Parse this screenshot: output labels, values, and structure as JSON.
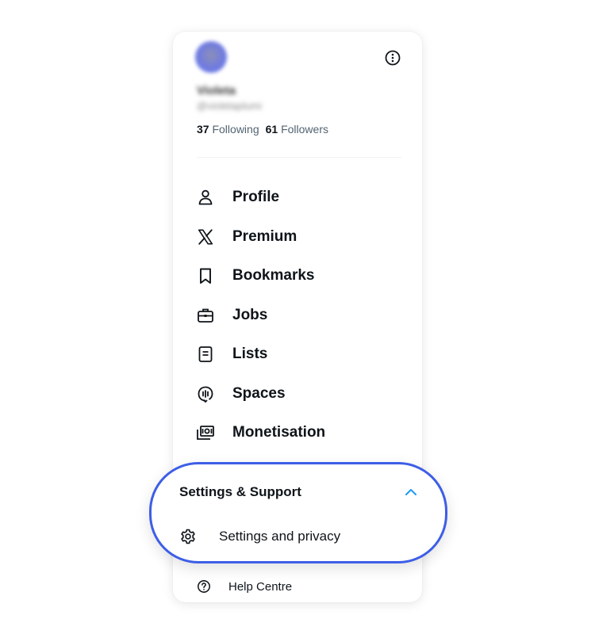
{
  "profile": {
    "name_blurred": "Violeta",
    "handle_blurred": "@violetaplumi",
    "following_count": "37",
    "following_label": "Following",
    "followers_count": "61",
    "followers_label": "Followers"
  },
  "nav": {
    "profile": "Profile",
    "premium": "Premium",
    "bookmarks": "Bookmarks",
    "jobs": "Jobs",
    "lists": "Lists",
    "spaces": "Spaces",
    "monetisation": "Monetisation"
  },
  "settings_support": {
    "title": "Settings & Support",
    "settings_and_privacy": "Settings and privacy",
    "help_centre": "Help Centre"
  },
  "colors": {
    "highlight_border": "#3d5ee6",
    "chevron": "#1d9bf0",
    "text_primary": "#0f1419",
    "text_secondary": "#536471"
  },
  "icons": [
    "more-icon",
    "person-icon",
    "x-logo-icon",
    "bookmark-icon",
    "briefcase-icon",
    "list-icon",
    "spaces-icon",
    "money-icon",
    "chevron-up-icon",
    "gear-icon",
    "help-icon"
  ]
}
